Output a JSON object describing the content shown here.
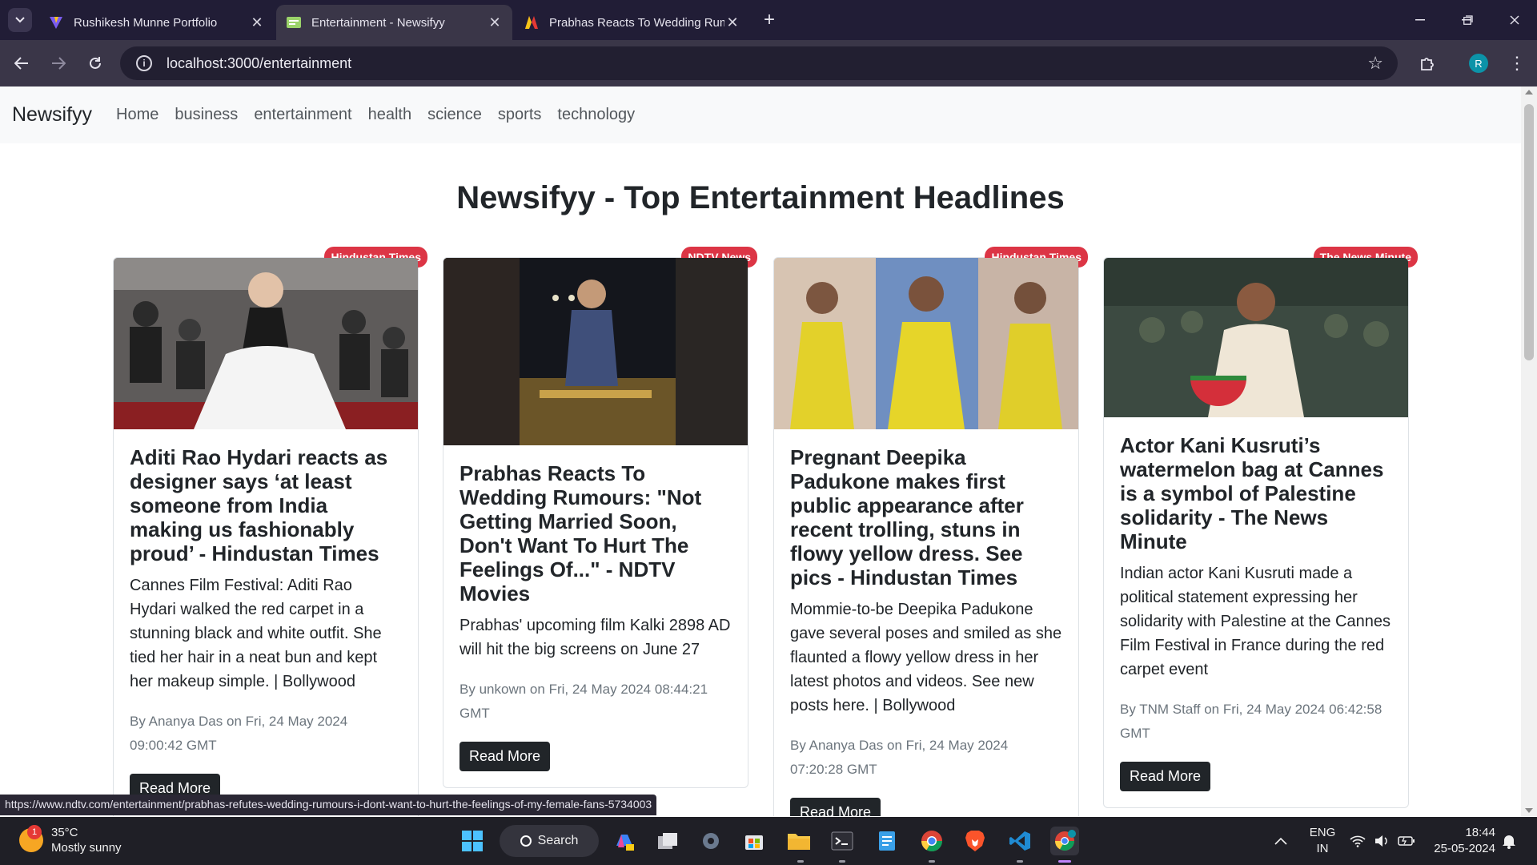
{
  "browser": {
    "tabs": [
      {
        "title": "Rushikesh Munne Portfolio",
        "active": false
      },
      {
        "title": "Entertainment - Newsifyy",
        "active": true
      },
      {
        "title": "Prabhas Reacts To Wedding Rumours",
        "active": false
      }
    ],
    "url": "localhost:3000/entertainment",
    "profile_initial": "R",
    "status_url": "https://www.ndtv.com/entertainment/prabhas-refutes-wedding-rumours-i-dont-want-to-hurt-the-feelings-of-my-female-fans-5734003"
  },
  "site": {
    "brand": "Newsifyy",
    "nav": [
      "Home",
      "business",
      "entertainment",
      "health",
      "science",
      "sports",
      "technology"
    ],
    "heading": "Newsifyy - Top Entertainment Headlines"
  },
  "articles": [
    {
      "source": "Hindustan Times",
      "title": "Aditi Rao Hydari reacts as designer says ‘at least someone from India making us fashionably proud’ - Hindustan Times",
      "description": "Cannes Film Festival: Aditi Rao Hydari walked the red carpet in a stunning black and white outfit. She tied her hair in a neat bun and kept her makeup simple. | Bollywood",
      "by_prefix": "By",
      "author": "Ananya Das",
      "on_prefix": "on",
      "date": "Fri, 24 May 2024 09:00:42 GMT",
      "button": "Read More"
    },
    {
      "source": "NDTV News",
      "title": "Prabhas Reacts To Wedding Rumours: \"Not Getting Married Soon, Don't Want To Hurt The Feelings Of...\" - NDTV Movies",
      "description": "Prabhas' upcoming film Kalki 2898 AD will hit the big screens on June 27",
      "by_prefix": "By",
      "author": "unkown",
      "on_prefix": "on",
      "date": "Fri, 24 May 2024 08:44:21 GMT",
      "button": "Read More"
    },
    {
      "source": "Hindustan Times",
      "title": "Pregnant Deepika Padukone makes first public appearance after recent trolling, stuns in flowy yellow dress. See pics - Hindustan Times",
      "description": "Mommie-to-be Deepika Padukone gave several poses and smiled as she flaunted a flowy yellow dress in her latest photos and videos. See new posts here. | Bollywood",
      "by_prefix": "By",
      "author": "Ananya Das",
      "on_prefix": "on",
      "date": "Fri, 24 May 2024 07:20:28 GMT",
      "button": "Read More"
    },
    {
      "source": "The News Minute",
      "title": "Actor Kani Kusruti’s watermelon bag at Cannes is a symbol of Palestine solidarity - The News Minute",
      "description": "Indian actor Kani Kusruti made a political statement expressing her solidarity with Palestine at the Cannes Film Festival in France during the red carpet event",
      "by_prefix": "By",
      "author": "TNM Staff",
      "on_prefix": "on",
      "date": "Fri, 24 May 2024 06:42:58 GMT",
      "button": "Read More"
    }
  ],
  "taskbar": {
    "weather_temp": "35°C",
    "weather_desc": "Mostly sunny",
    "weather_alert": "1",
    "search_label": "Search",
    "lang_line1": "ENG",
    "lang_line2": "IN",
    "time": "18:44",
    "date": "25-05-2024"
  },
  "colors": {
    "badge": "#dc3545",
    "button": "#212529",
    "chrome_dark": "#211d36",
    "chrome_toolbar": "#3a3648"
  }
}
